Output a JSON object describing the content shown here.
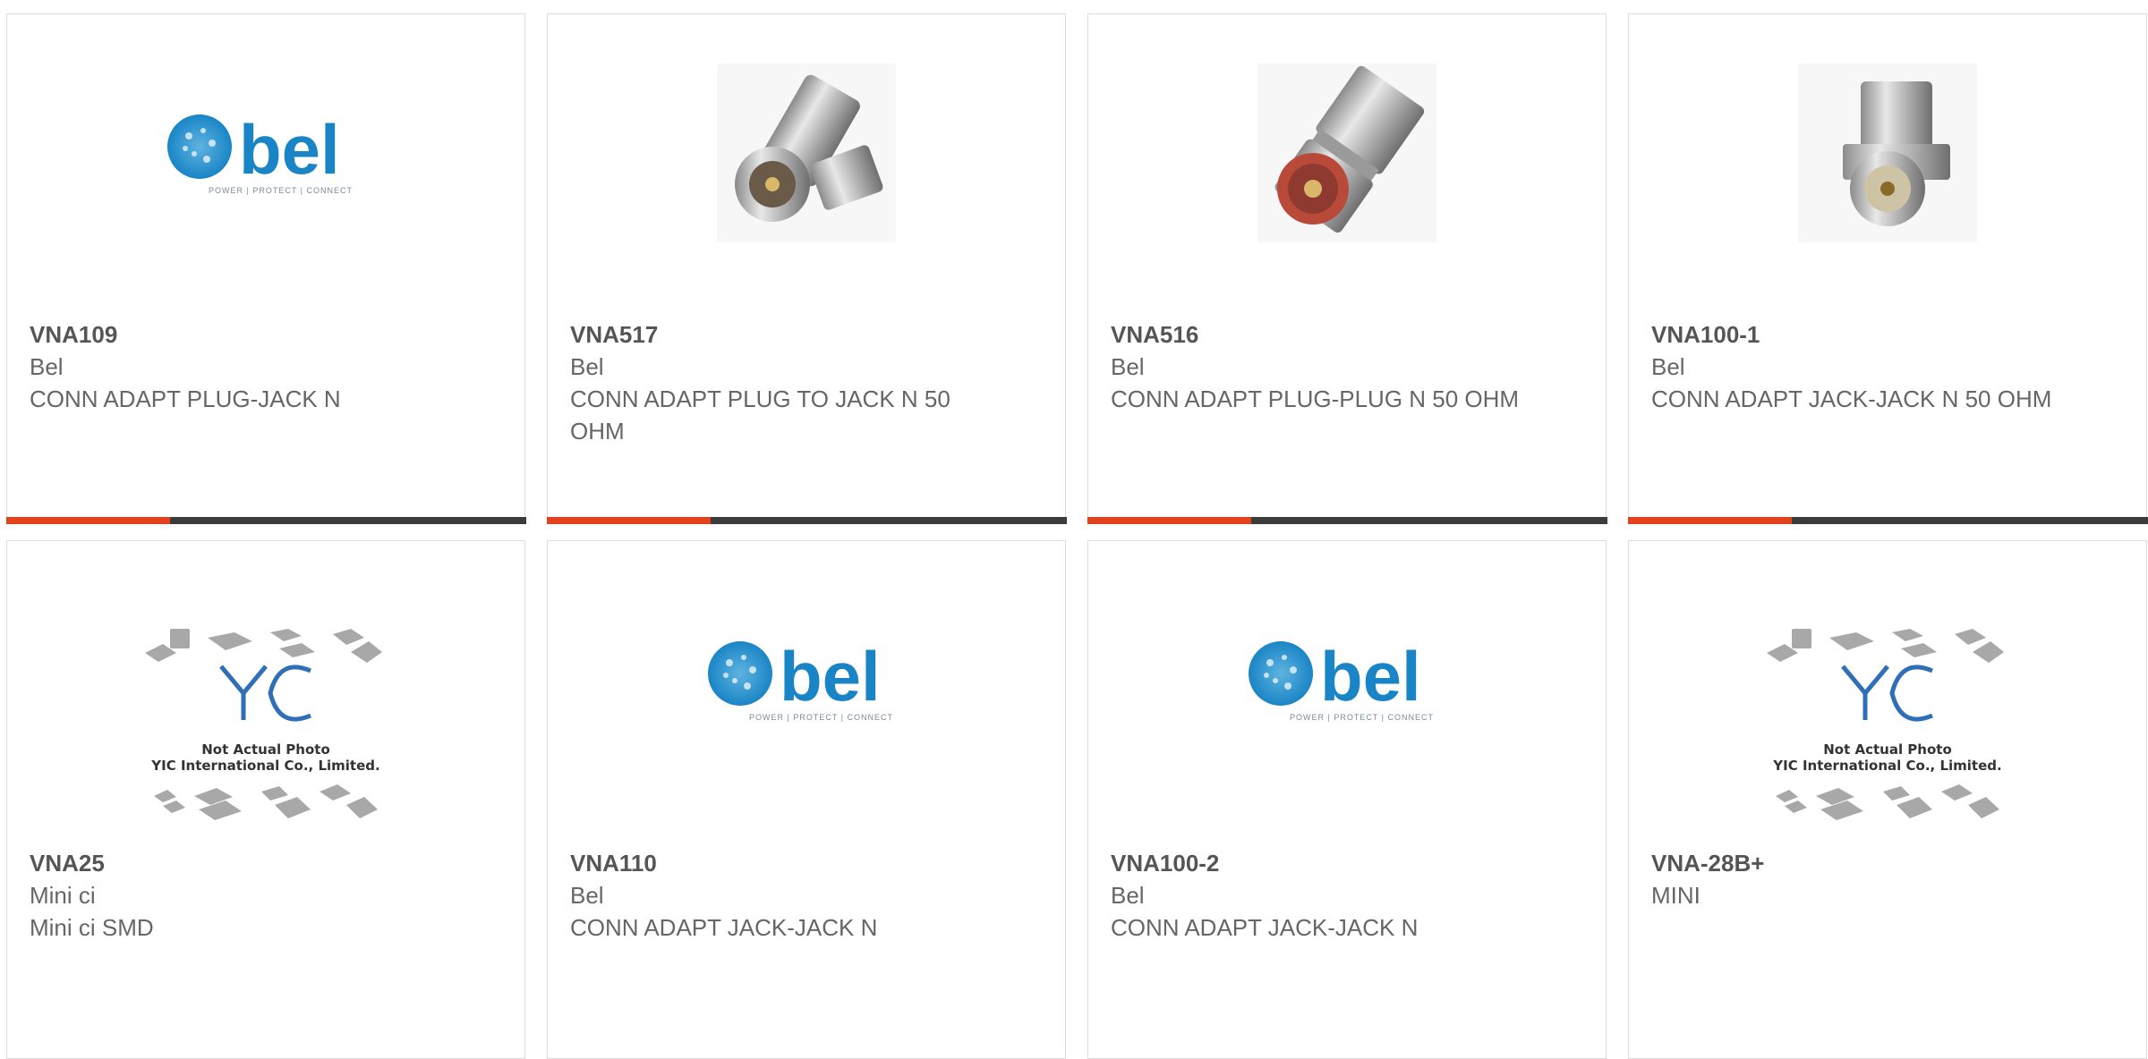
{
  "products": [
    {
      "part": "VNA109",
      "manufacturer": "Bel",
      "description": "CONN ADAPT PLUG-JACK N",
      "image": "bel-logo"
    },
    {
      "part": "VNA517",
      "manufacturer": "Bel",
      "description": "CONN ADAPT PLUG TO JACK N 50 OHM",
      "image": "right-angle-n-adapter-photo"
    },
    {
      "part": "VNA516",
      "manufacturer": "Bel",
      "description": "CONN ADAPT PLUG-PLUG N 50 OHM",
      "image": "plug-plug-n-adapter-photo"
    },
    {
      "part": "VNA100-1",
      "manufacturer": "Bel",
      "description": "CONN ADAPT JACK-JACK N 50 OHM",
      "image": "bulkhead-jack-adapter-photo"
    },
    {
      "part": "VNA25",
      "manufacturer": "Mini ci",
      "description": "Mini ci SMD",
      "image": "yic-placeholder"
    },
    {
      "part": "VNA110",
      "manufacturer": "Bel",
      "description": "CONN ADAPT JACK-JACK N",
      "image": "bel-logo"
    },
    {
      "part": "VNA100-2",
      "manufacturer": "Bel",
      "description": "CONN ADAPT JACK-JACK N",
      "image": "bel-logo"
    },
    {
      "part": "VNA-28B+",
      "manufacturer": "MINI",
      "description": "",
      "image": "yic-placeholder"
    }
  ],
  "bel_logo": {
    "word": "bel",
    "tagline": "POWER | PROTECT | CONNECT"
  },
  "yic": {
    "mark": "YIC",
    "line1": "Not Actual Photo",
    "line2": "YIC International Co., Limited."
  },
  "colors": {
    "accent": "#e2431e",
    "bar": "#3c3c3c",
    "bel_blue": "#1a85c6"
  }
}
